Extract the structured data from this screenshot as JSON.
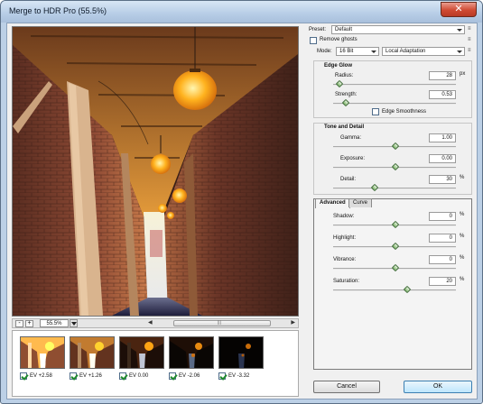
{
  "window": {
    "title": "Merge to HDR Pro (55.5%)",
    "close_label": "✕"
  },
  "preview": {
    "zoom": "55.5%",
    "zoom_out": "-",
    "zoom_in": "+",
    "scroll_left": "◀",
    "scroll_right": "▶",
    "scroll_grip": "|||"
  },
  "sources": [
    {
      "ev": "EV +2.58",
      "checked": true,
      "brightness": 1.35
    },
    {
      "ev": "EV +1.26",
      "checked": true,
      "brightness": 1.1
    },
    {
      "ev": "EV 0.00",
      "checked": true,
      "brightness": 0.7
    },
    {
      "ev": "EV -2.06",
      "checked": true,
      "brightness": 0.45
    },
    {
      "ev": "EV -3.32",
      "checked": true,
      "brightness": 0.3
    }
  ],
  "panel": {
    "preset_label": "Preset:",
    "preset_value": "Default",
    "menu_glyph": "≡",
    "remove_ghosts_label": "Remove ghosts",
    "remove_ghosts_checked": false,
    "mode_label": "Mode:",
    "mode_bits": "16 Bit",
    "mode_method": "Local Adaptation",
    "edge_glow": {
      "title": "Edge Glow",
      "radius_label": "Radius:",
      "radius_value": "28",
      "radius_unit": "px",
      "radius_level": 0.05,
      "strength_label": "Strength:",
      "strength_value": "0.53",
      "strength_level": 0.1,
      "edge_smoothness_label": "Edge Smoothness",
      "edge_smoothness_checked": false
    },
    "tone_detail": {
      "title": "Tone and Detail",
      "gamma_label": "Gamma:",
      "gamma_value": "1.00",
      "gamma_level": 0.5,
      "exposure_label": "Exposure:",
      "exposure_value": "0.00",
      "exposure_level": 0.5,
      "detail_label": "Detail:",
      "detail_value": "30",
      "detail_unit": "%",
      "detail_level": 0.33
    },
    "tabs": [
      "Advanced",
      "Curve"
    ],
    "advanced": {
      "shadow_label": "Shadow:",
      "shadow_value": "0",
      "shadow_level": 0.5,
      "highlight_label": "Highlight:",
      "highlight_value": "0",
      "highlight_level": 0.5,
      "vibrance_label": "Vibrance:",
      "vibrance_value": "0",
      "vibrance_level": 0.5,
      "saturation_label": "Saturation:",
      "saturation_value": "20",
      "saturation_level": 0.6,
      "unit": "%"
    },
    "cancel_label": "Cancel",
    "ok_label": "OK"
  }
}
